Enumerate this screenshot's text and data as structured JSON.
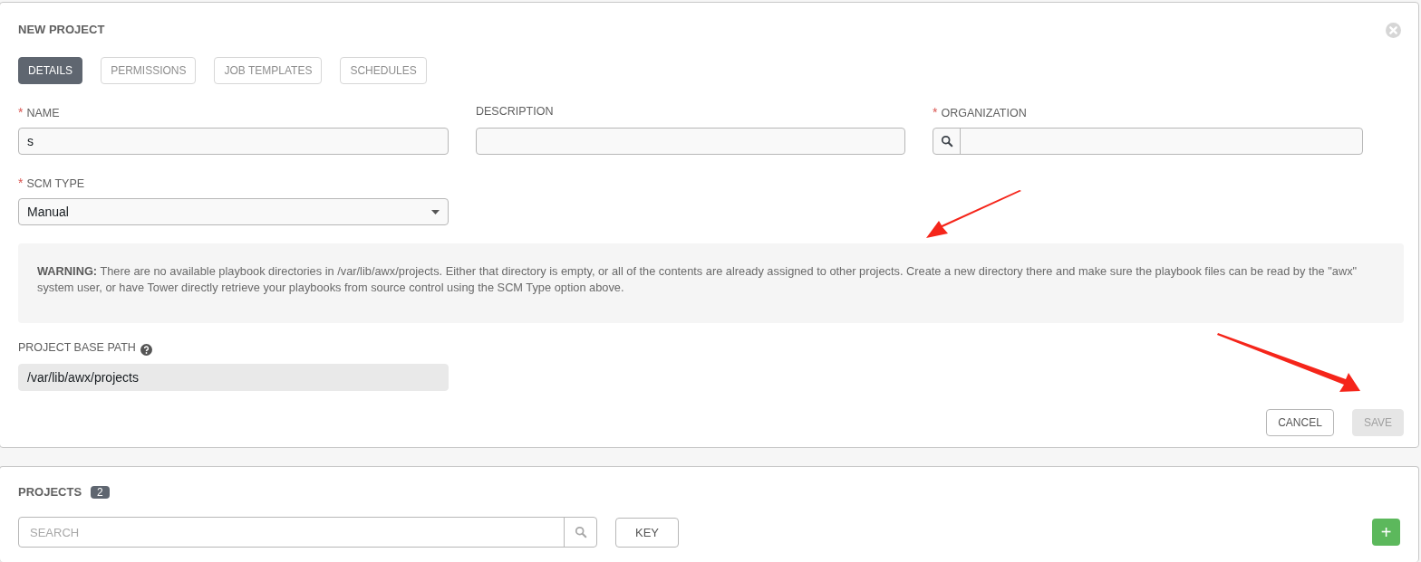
{
  "form": {
    "title": "NEW PROJECT",
    "tabs": [
      {
        "label": "DETAILS",
        "selected": true
      },
      {
        "label": "PERMISSIONS",
        "selected": false
      },
      {
        "label": "JOB TEMPLATES",
        "selected": false
      },
      {
        "label": "SCHEDULES",
        "selected": false
      }
    ],
    "fields_row": [
      {
        "label": "NAME",
        "required_mark": "*",
        "kind": "text",
        "value": "s"
      },
      {
        "label": "DESCRIPTION",
        "kind": "text"
      },
      {
        "label": "ORGANIZATION",
        "required_mark": "*",
        "kind": "lookup"
      }
    ],
    "scm_type": {
      "label": "SCM TYPE",
      "required_mark": "*",
      "value": "Manual"
    },
    "warning": "**WARNING:** There are no available playbook directories in /var/lib/awx/projects. Either that directory is empty, or all of the contents are already assigned to other projects. Create a new directory there and make sure the playbook files can be read by the \"awx\" system user, or have Tower directly retrieve your playbooks from source control using the SCM Type option above.",
    "base_path": {
      "label": "PROJECT BASE PATH",
      "value": "/var/lib/awx/projects"
    },
    "buttons": [
      {
        "label": "CANCEL",
        "disabled": false
      },
      {
        "label": "SAVE",
        "disabled": true
      }
    ]
  },
  "projects": {
    "title": "PROJECTS",
    "count": "2",
    "search": {
      "placeholder": "SEARCH"
    },
    "key_button": "KEY",
    "add_button": "+"
  }
}
